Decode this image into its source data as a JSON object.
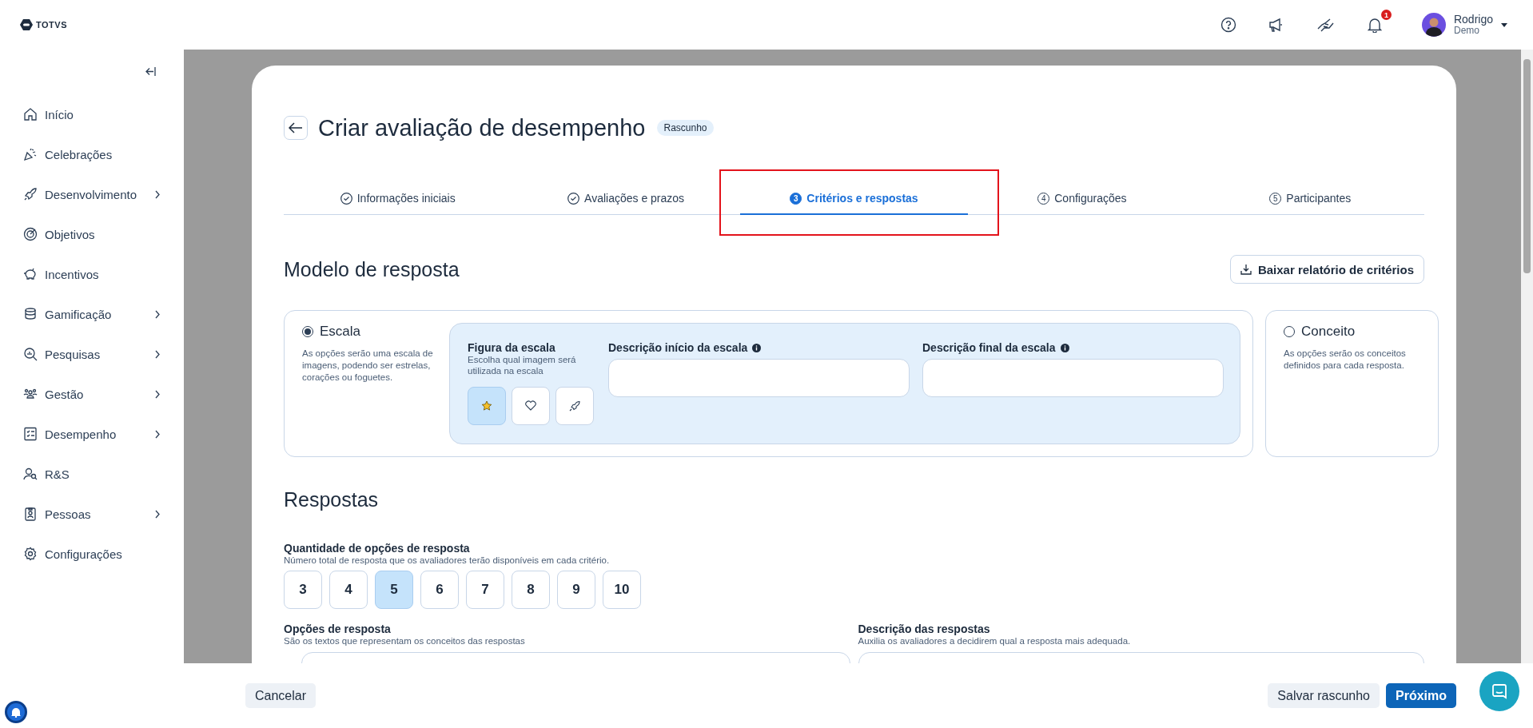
{
  "app": {
    "logo": "TOTVS"
  },
  "header": {
    "notification_count": "1",
    "user": {
      "name": "Rodrigo",
      "subtitle": "Demo"
    }
  },
  "sidebar": {
    "items": [
      {
        "label": "Início",
        "has_children": false
      },
      {
        "label": "Celebrações",
        "has_children": false
      },
      {
        "label": "Desenvolvimento",
        "has_children": true
      },
      {
        "label": "Objetivos",
        "has_children": false
      },
      {
        "label": "Incentivos",
        "has_children": false
      },
      {
        "label": "Gamificação",
        "has_children": true
      },
      {
        "label": "Pesquisas",
        "has_children": true
      },
      {
        "label": "Gestão",
        "has_children": true
      },
      {
        "label": "Desempenho",
        "has_children": true
      },
      {
        "label": "R&S",
        "has_children": false
      },
      {
        "label": "Pessoas",
        "has_children": true
      },
      {
        "label": "Configurações",
        "has_children": false
      }
    ]
  },
  "page": {
    "title": "Criar avaliação de desempenho",
    "status_badge": "Rascunho",
    "steps": [
      {
        "label": "Informações iniciais",
        "completed": true,
        "selected": false,
        "highlighted": false
      },
      {
        "label": "Avaliações e prazos",
        "completed": true,
        "selected": false,
        "highlighted": false
      },
      {
        "number": "3",
        "label": "Critérios e respostas",
        "completed": false,
        "selected": true,
        "highlighted": true
      },
      {
        "number": "4",
        "label": "Configurações",
        "completed": false,
        "selected": false,
        "highlighted": false
      },
      {
        "number": "5",
        "label": "Participantes",
        "completed": false,
        "selected": false,
        "highlighted": false
      }
    ]
  },
  "response_model": {
    "title": "Modelo de resposta",
    "download_button": "Baixar relatório de critérios",
    "options": [
      {
        "label": "Escala",
        "description": "As opções serão uma escala de imagens, podendo ser estrelas, corações ou foguetes.",
        "selected": true
      },
      {
        "label": "Conceito",
        "description": "As opções serão os conceitos definidos para cada resposta.",
        "selected": false
      }
    ],
    "scale": {
      "figure_label": "Figura da escala",
      "figure_hint": "Escolha qual imagem será utilizada na escala",
      "figures": [
        {
          "kind": "star",
          "selected": true
        },
        {
          "kind": "heart",
          "selected": false
        },
        {
          "kind": "rocket",
          "selected": false
        }
      ],
      "start_label": "Descrição início da escala",
      "end_label": "Descrição final da escala"
    }
  },
  "answers": {
    "title": "Respostas",
    "quantity_label": "Quantidade de opções de resposta",
    "quantity_hint": "Número total de resposta que os avaliadores terão disponíveis em cada critério.",
    "quantity_options": [
      {
        "label": "3",
        "selected": false
      },
      {
        "label": "4",
        "selected": false
      },
      {
        "label": "5",
        "selected": true
      },
      {
        "label": "6",
        "selected": false
      },
      {
        "label": "7",
        "selected": false
      },
      {
        "label": "8",
        "selected": false
      },
      {
        "label": "9",
        "selected": false
      },
      {
        "label": "10",
        "selected": false
      }
    ],
    "options_label": "Opções de resposta",
    "options_hint": "São os textos que representam os conceitos das respostas",
    "descriptions_label": "Descrição das respostas",
    "descriptions_hint": "Auxilia os avaliadores a decidirem qual a resposta mais adequada."
  },
  "footer": {
    "cancel": "Cancelar",
    "save_draft": "Salvar rascunho",
    "next": "Próximo"
  }
}
